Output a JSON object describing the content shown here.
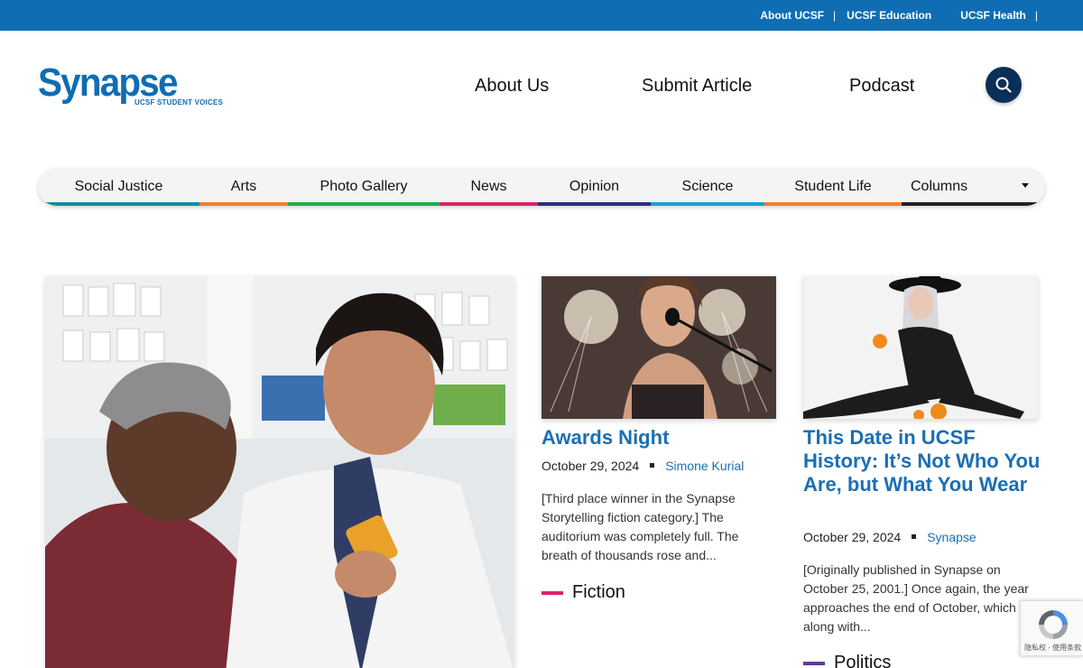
{
  "topbar": {
    "links": [
      "About UCSF",
      "UCSF Education",
      "UCSF Health"
    ],
    "separator": "|"
  },
  "header": {
    "logo_word": "Synapse",
    "logo_tagline": "UCSF STUDENT VOICES",
    "nav": [
      "About Us",
      "Submit Article",
      "Podcast"
    ],
    "search_icon": "search-icon"
  },
  "categories": [
    {
      "label": "Social Justice",
      "color": "#0e8f9b"
    },
    {
      "label": "Arts",
      "color": "#f07f2c"
    },
    {
      "label": "Photo Gallery",
      "color": "#1fae4b"
    },
    {
      "label": "News",
      "color": "#d7266a"
    },
    {
      "label": "Opinion",
      "color": "#2b2d7e"
    },
    {
      "label": "Science",
      "color": "#1aa0d4"
    },
    {
      "label": "Student Life",
      "color": "#f07f2c"
    },
    {
      "label": "Columns",
      "color": "#222222"
    }
  ],
  "articles": [
    {
      "title": "Awards Night",
      "date": "October 29, 2024",
      "author": "Simone Kurial",
      "excerpt": "[Third place winner in the Synapse Storytelling fiction category.] The auditorium was completely full. The breath of thousands rose and...",
      "tag": "Fiction",
      "tag_color": "#d7266a"
    },
    {
      "title": "This Date in UCSF History: It’s Not Who You Are, but What You Wear",
      "date": "October 29, 2024",
      "author": "Synapse",
      "excerpt": "[Originally published in Synapse on October 25, 2001.] Once again, the year approaches the end of October, which along with...",
      "tag": "Politics",
      "tag_color": "#5a3d9a"
    }
  ],
  "recaptcha": {
    "text": "隐私权 - 使用条款"
  }
}
